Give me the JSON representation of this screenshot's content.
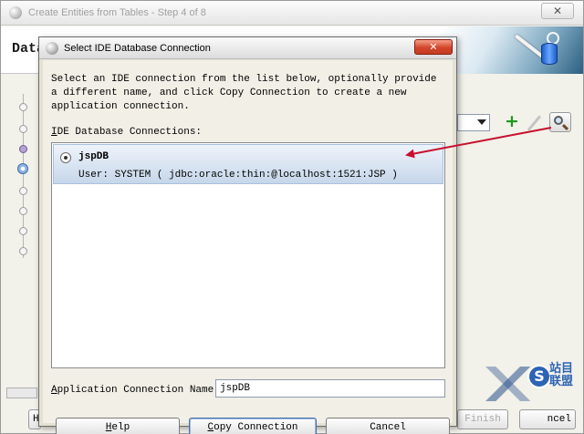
{
  "background_window": {
    "title": "Create Entities from Tables - Step 4 of 8",
    "close_label": "✕",
    "header_title": "Data",
    "help_label": "H",
    "finish_label": "Finish",
    "cancel_label": "ncel"
  },
  "dialog": {
    "title": "Select IDE Database Connection",
    "close_label": "✕",
    "instructions": "Select an IDE connection from the list below, optionally provide a different name, and click Copy Connection to create a new application connection.",
    "list_label_mnemonic": "I",
    "list_label_rest": "DE Database Connections:",
    "connections": [
      {
        "name": "jspDB",
        "detail": "User: SYSTEM ( jdbc:oracle:thin:@localhost:1521:JSP )",
        "selected": true
      }
    ],
    "app_name_label_mnemonic": "A",
    "app_name_label_rest": "pplication Connection Name:",
    "app_name_value": "jspDB",
    "buttons": {
      "help_mnemonic": "H",
      "help_rest": "elp",
      "copy_mnemonic": "C",
      "copy_rest": "opy Connection",
      "cancel": "Cancel"
    }
  },
  "annotation": {
    "arrow_color": "#c8102e"
  },
  "watermark": {
    "badge": "S",
    "text": "站目联盟"
  }
}
